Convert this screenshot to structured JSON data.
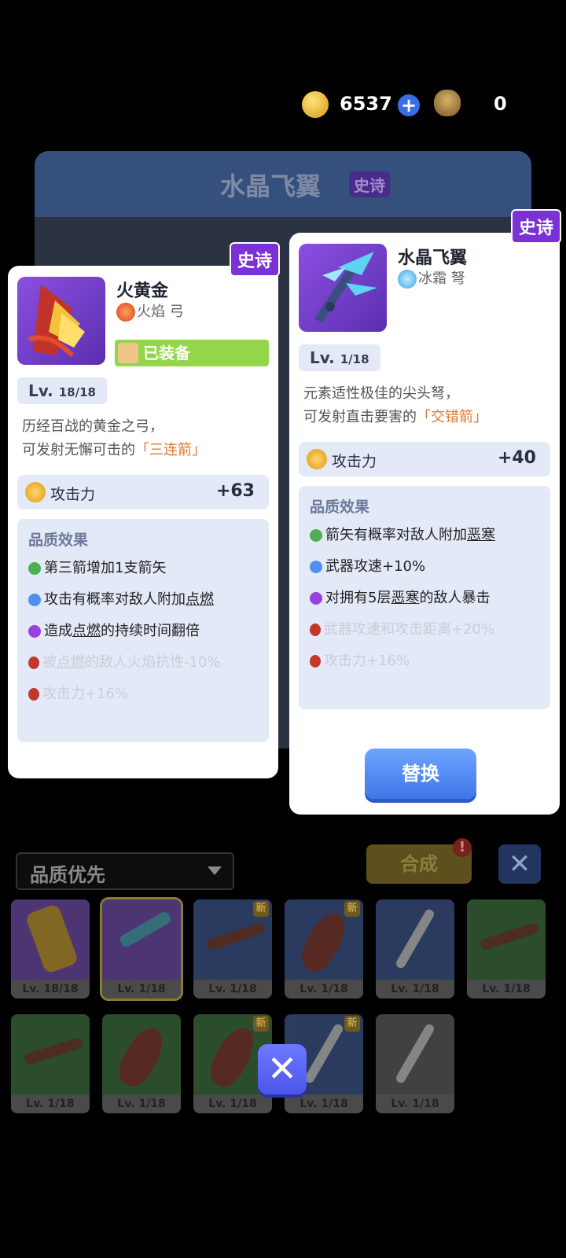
{
  "topbar": {
    "coins": "6537",
    "bag_count": "0",
    "plus_icon": "+"
  },
  "background_panel": {
    "title": "水晶飞翼",
    "rarity": "史诗"
  },
  "left_card": {
    "rarity": "史诗",
    "name": "火黄金",
    "element": "火焰",
    "weapon_type": "弓",
    "equipped_label": "已装备",
    "level_prefix": "Lv.",
    "level": "18/18",
    "desc_line1": "历经百战的黄金之弓，",
    "desc_line2_pre": "可发射无懈可击的",
    "desc_line2_hl": "「三连箭」",
    "attack_label": "攻击力",
    "attack_value": "+63",
    "effects_title": "品质效果",
    "effects": [
      {
        "color": "green",
        "text": "第三箭增加1支箭矢"
      },
      {
        "color": "blue",
        "pre": "攻击有概率对敌人附加",
        "u": "点燃"
      },
      {
        "color": "purple",
        "pre": "造成",
        "u": "点燃",
        "post": "的持续时间翻倍"
      },
      {
        "color": "locked",
        "pre": "被",
        "u": "点燃",
        "post": "的敌人火焰抗性-10%"
      },
      {
        "color": "locked",
        "text": "攻击力+16%"
      }
    ]
  },
  "right_card": {
    "rarity": "史诗",
    "name": "水晶飞翼",
    "element": "冰霜",
    "weapon_type": "弩",
    "level_prefix": "Lv.",
    "level": "1/18",
    "desc_line1": "元素适性极佳的尖头弩，",
    "desc_line2_pre": "可发射直击要害的",
    "desc_line2_hl": "「交错箭」",
    "attack_label": "攻击力",
    "attack_value": "+40",
    "effects_title": "品质效果",
    "effects": [
      {
        "color": "green",
        "pre": "箭矢有概率对敌人附加",
        "u": "恶寒"
      },
      {
        "color": "blue",
        "text": "武器攻速+10%"
      },
      {
        "color": "purple",
        "pre": "对拥有5层",
        "u": "恶寒",
        "post": "的敌人暴击"
      },
      {
        "color": "locked",
        "text": "武器攻速和攻击距离+20%"
      },
      {
        "color": "locked",
        "text": "攻击力+16%"
      }
    ],
    "replace_label": "替换"
  },
  "toolbar": {
    "sort_label": "品质优先",
    "synth_label": "合成",
    "synth_alert": "!",
    "close_icon": "✕"
  },
  "inventory": [
    {
      "level": "Lv. 18/18",
      "kind": "bow-gold",
      "new": false
    },
    {
      "level": "Lv. 1/18",
      "kind": "crossbow-ice",
      "new": false,
      "selected": true
    },
    {
      "level": "Lv. 1/18",
      "kind": "crossbow",
      "new": true
    },
    {
      "level": "Lv. 1/18",
      "kind": "club",
      "new": true
    },
    {
      "level": "Lv. 1/18",
      "kind": "daggers",
      "new": false
    },
    {
      "level": "Lv. 1/18",
      "kind": "crossbow",
      "new": false
    },
    {
      "level": "Lv. 1/18",
      "kind": "crossbow",
      "new": false
    },
    {
      "level": "Lv. 1/18",
      "kind": "club",
      "new": false
    },
    {
      "level": "Lv. 1/18",
      "kind": "club",
      "new": true
    },
    {
      "level": "Lv. 1/18",
      "kind": "daggers",
      "new": true
    },
    {
      "level": "Lv. 1/18",
      "kind": "daggers",
      "new": false
    }
  ],
  "new_badge": "新",
  "overlay_close_icon": "✕"
}
